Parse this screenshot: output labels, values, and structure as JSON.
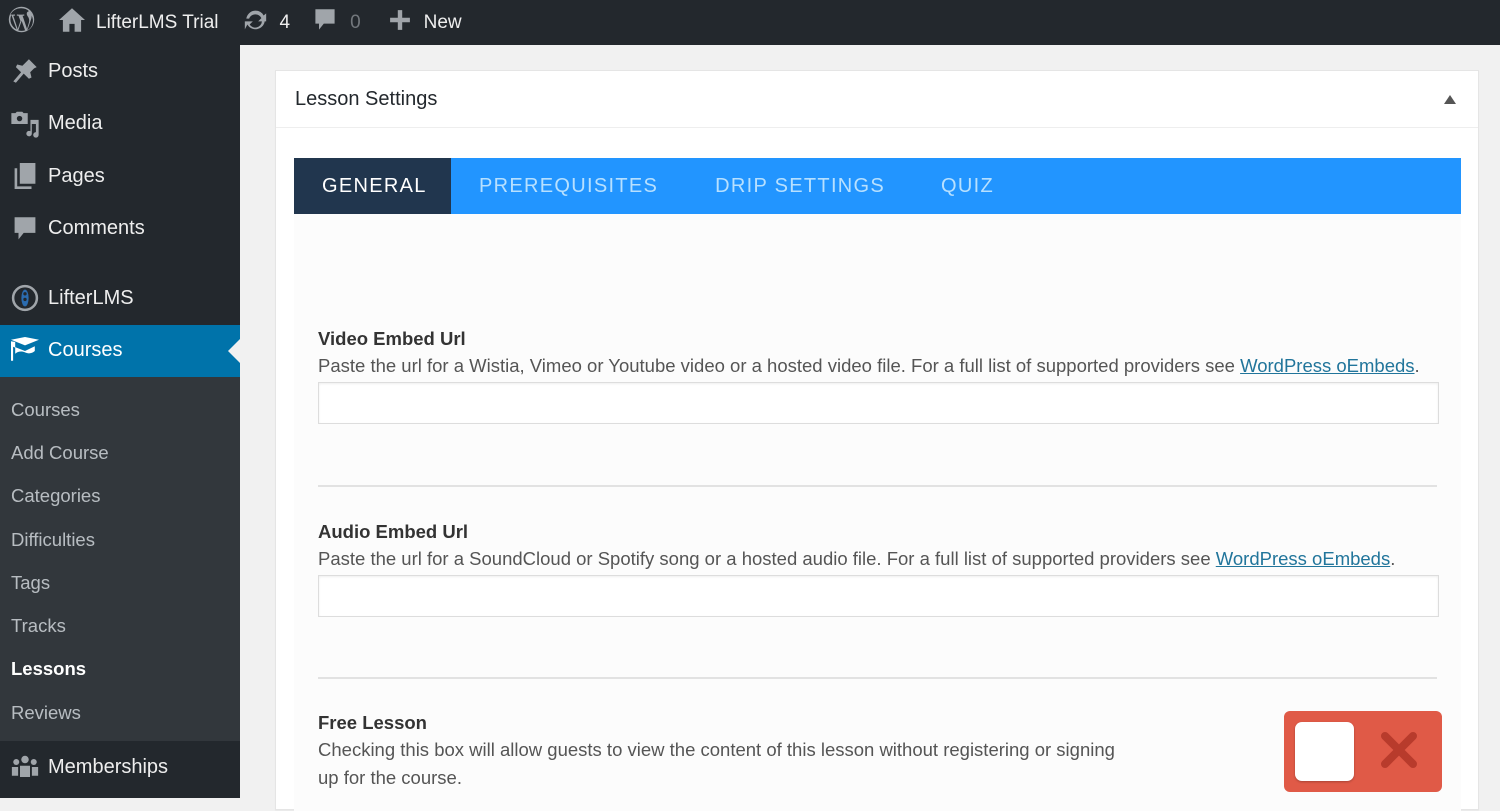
{
  "adminbar": {
    "site_name": "LifterLMS Trial",
    "updates_count": "4",
    "comments_count": "0",
    "new_label": "New"
  },
  "sidebar": {
    "items": [
      {
        "label": "Posts",
        "icon": "pin-icon"
      },
      {
        "label": "Media",
        "icon": "media-icon"
      },
      {
        "label": "Pages",
        "icon": "pages-icon"
      },
      {
        "label": "Comments",
        "icon": "comment-icon"
      },
      {
        "label": "LifterLMS",
        "icon": "lifterlms-icon"
      },
      {
        "label": "Courses",
        "icon": "graduation-cap-icon",
        "active": true
      }
    ],
    "submenu": [
      {
        "label": "Courses"
      },
      {
        "label": "Add Course"
      },
      {
        "label": "Categories"
      },
      {
        "label": "Difficulties"
      },
      {
        "label": "Tags"
      },
      {
        "label": "Tracks"
      },
      {
        "label": "Lessons",
        "current": true
      },
      {
        "label": "Reviews"
      }
    ],
    "memberships": {
      "label": "Memberships",
      "icon": "groups-icon"
    }
  },
  "postbox": {
    "title": "Lesson Settings",
    "tabs": [
      {
        "label": "GENERAL",
        "active": true
      },
      {
        "label": "PREREQUISITES"
      },
      {
        "label": "DRIP SETTINGS"
      },
      {
        "label": "QUIZ"
      }
    ],
    "colors": {
      "tab_bar": "#2295ff",
      "tab_active": "#21364e",
      "sidebar_active": "#0073aa",
      "switch_off": "#e05a47"
    }
  },
  "fields": {
    "video": {
      "label": "Video Embed Url",
      "desc": "Paste the url for a Wistia, Vimeo or Youtube video or a hosted video file. For a full list of supported providers see ",
      "link": "WordPress oEmbeds",
      "suffix": ".",
      "value": "",
      "placeholder": ""
    },
    "audio": {
      "label": "Audio Embed Url",
      "desc": "Paste the url for a SoundCloud or Spotify song or a hosted audio file. For a full list of supported providers see ",
      "link": "WordPress oEmbeds",
      "suffix": ".",
      "value": "",
      "placeholder": ""
    },
    "free_lesson": {
      "label": "Free Lesson",
      "desc": "Checking this box will allow guests to view the content of this lesson without registering or signing up for the course.",
      "checked": false
    }
  }
}
